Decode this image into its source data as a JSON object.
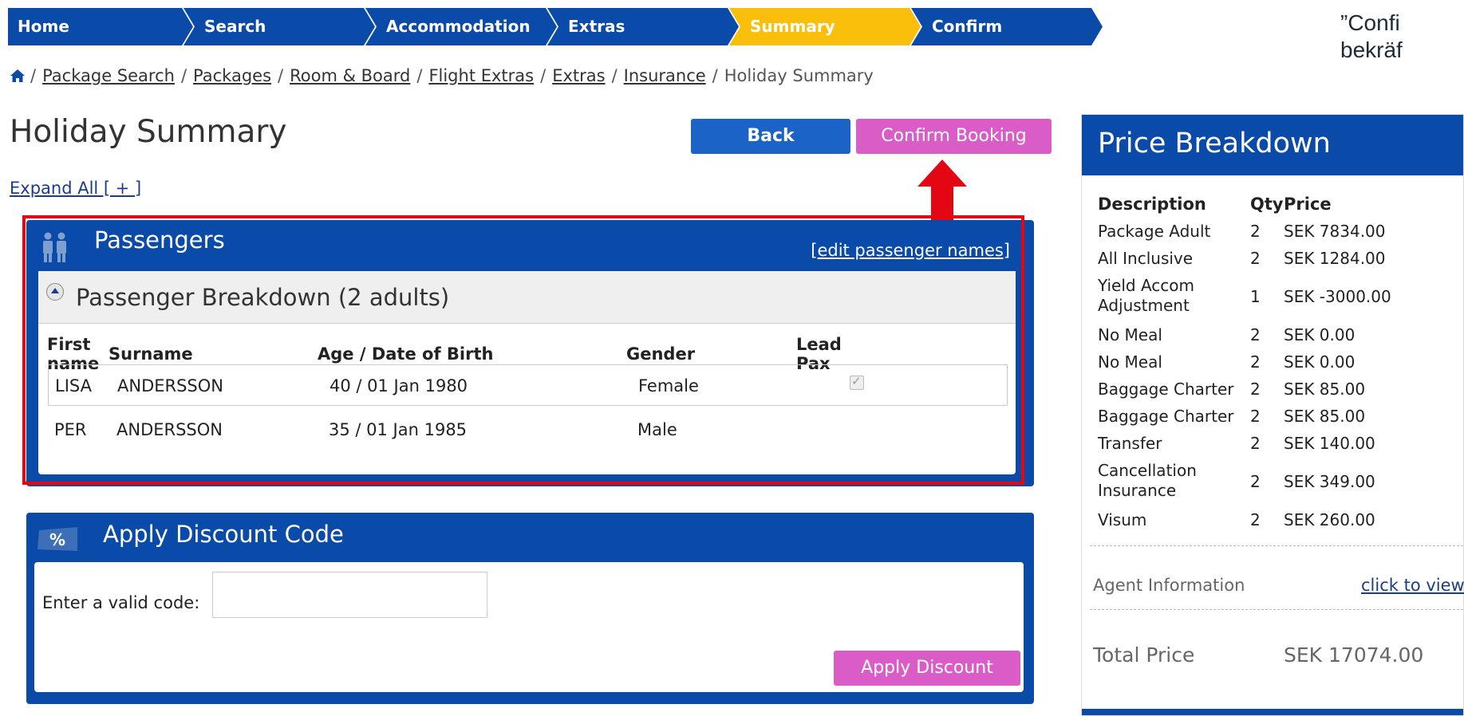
{
  "steps": [
    {
      "label": "Home"
    },
    {
      "label": "Search"
    },
    {
      "label": "Accommodation"
    },
    {
      "label": "Extras"
    },
    {
      "label": "Summary",
      "active": true
    },
    {
      "label": "Confirm"
    }
  ],
  "callout": {
    "line1": "”Confi",
    "line2": "bekräf"
  },
  "breadcrumb": {
    "items": [
      "Package Search",
      "Packages",
      "Room & Board",
      "Flight Extras",
      "Extras",
      "Insurance"
    ],
    "current": "Holiday Summary"
  },
  "header": {
    "title": "Holiday Summary",
    "back_label": "Back",
    "confirm_label": "Confirm Booking",
    "expand_label": "Expand All [ + ]"
  },
  "passengers": {
    "title": "Passengers",
    "edit_label": "[edit passenger names]",
    "breakdown_title": "Passenger Breakdown (2 adults)",
    "columns": {
      "first_1": "First",
      "first_2": "name",
      "surname": "Surname",
      "age": "Age / Date of Birth",
      "gender": "Gender",
      "lead_1": "Lead",
      "lead_2": "Pax"
    },
    "rows": [
      {
        "first": "LISA",
        "surname": "ANDERSSON",
        "age": "40 / 01 Jan 1980",
        "gender": "Female",
        "lead": true
      },
      {
        "first": "PER",
        "surname": "ANDERSSON",
        "age": "35 / 01 Jan 1985",
        "gender": "Male",
        "lead": false
      }
    ]
  },
  "discount": {
    "title": "Apply Discount Code",
    "icon_text": "%",
    "label": "Enter a valid code:",
    "value": "",
    "button": "Apply Discount"
  },
  "price": {
    "title": "Price Breakdown",
    "columns": {
      "desc": "Description",
      "qty": "Qty",
      "price": "Price"
    },
    "rows": [
      {
        "d1": "Package Adult",
        "d2": "",
        "q": "2",
        "p": "SEK 7834.00"
      },
      {
        "d1": "All Inclusive",
        "d2": "",
        "q": "2",
        "p": "SEK 1284.00"
      },
      {
        "d1": "Yield Accom",
        "d2": "Adjustment",
        "q": "1",
        "p": "SEK -3000.00"
      },
      {
        "d1": "No Meal",
        "d2": "",
        "q": "2",
        "p": "SEK 0.00"
      },
      {
        "d1": "No Meal",
        "d2": "",
        "q": "2",
        "p": "SEK 0.00"
      },
      {
        "d1": "Baggage Charter",
        "d2": "",
        "q": "2",
        "p": "SEK 85.00"
      },
      {
        "d1": "Baggage Charter",
        "d2": "",
        "q": "2",
        "p": "SEK 85.00"
      },
      {
        "d1": "Transfer",
        "d2": "",
        "q": "2",
        "p": "SEK 140.00"
      },
      {
        "d1": "Cancellation",
        "d2": "Insurance",
        "q": "2",
        "p": "SEK 349.00"
      },
      {
        "d1": "Visum",
        "d2": "",
        "q": "2",
        "p": "SEK 260.00"
      }
    ],
    "agent_label": "Agent Information",
    "agent_link": "click to view",
    "total_label": "Total Price",
    "total_value": "SEK  17074.00"
  },
  "colors": {
    "brand_blue": "#0a4aa8",
    "active_step": "#f9bf0b",
    "confirm_pink": "#d95cc7",
    "highlight_red": "#e30613"
  }
}
